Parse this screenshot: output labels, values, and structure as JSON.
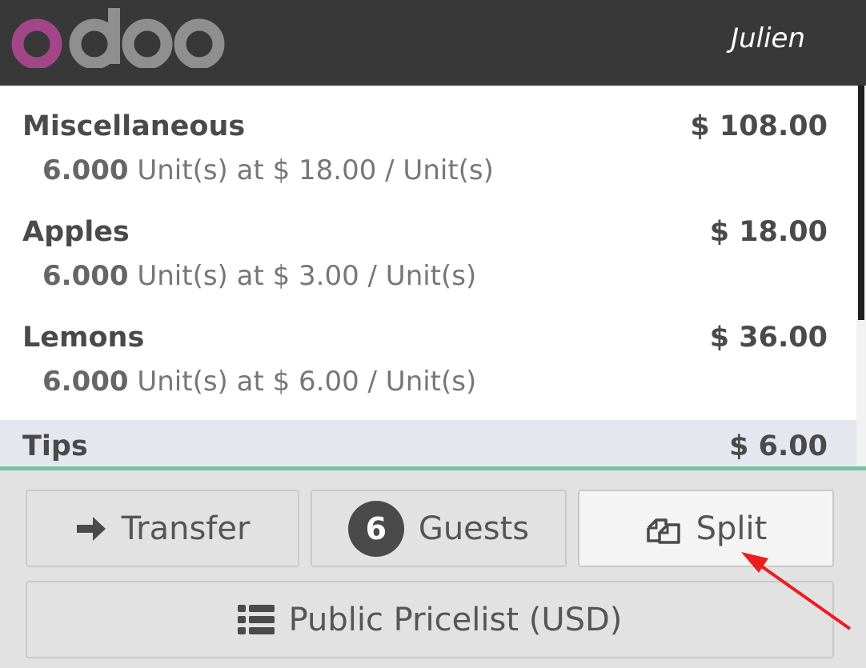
{
  "header": {
    "logo_text": "odoo",
    "user": "Julien"
  },
  "orderlines": [
    {
      "name": "Miscellaneous",
      "price": "$ 108.00",
      "qty": "6.000",
      "detail": " Unit(s) at $ 18.00 / Unit(s)"
    },
    {
      "name": "Apples",
      "price": "$ 18.00",
      "qty": "6.000",
      "detail": " Unit(s) at $ 3.00 / Unit(s)"
    },
    {
      "name": "Lemons",
      "price": "$ 36.00",
      "qty": "6.000",
      "detail": " Unit(s) at $ 6.00 / Unit(s)"
    },
    {
      "name": "Tips",
      "price": "$ 6.00"
    }
  ],
  "actions": {
    "transfer_label": "Transfer",
    "guests_count": "6",
    "guests_label": "Guests",
    "split_label": "Split",
    "pricelist_label": "Public Pricelist (USD)"
  },
  "colors": {
    "topbar": "#383838",
    "logo_accent": "#a24689",
    "logo_gray": "#8f8f8f",
    "separator": "#6ec89b",
    "annotation_arrow": "#ee1c1c"
  }
}
